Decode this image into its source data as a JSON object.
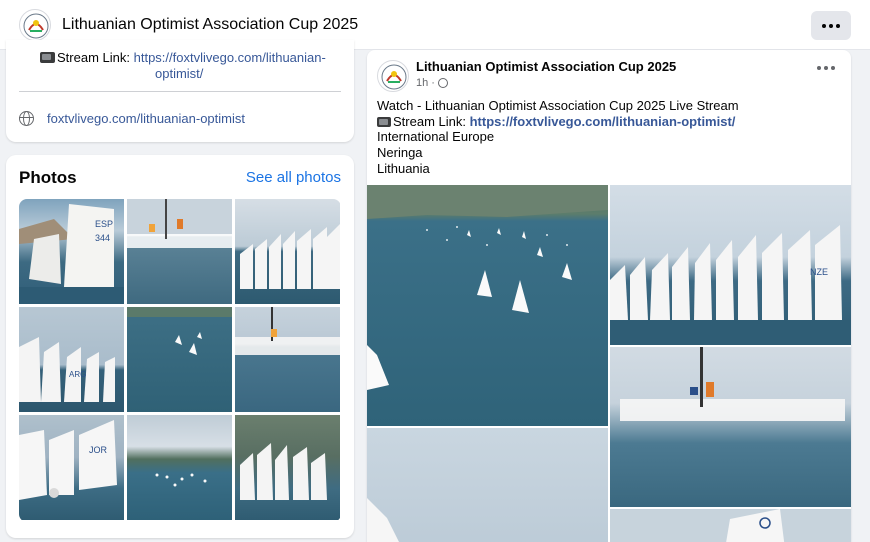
{
  "header": {
    "title": "Lithuanian Optimist Association Cup 2025",
    "more_icon": "more-horizontal-icon"
  },
  "intro": {
    "stream_prefix": "Stream Link:",
    "stream_url_line1": "https://foxtvlivego.com/lithuanian-",
    "stream_url_line2": "optimist/",
    "website": "foxtvlivego.com/lithuanian-optimist"
  },
  "photos": {
    "title": "Photos",
    "see_all": "See all photos"
  },
  "post": {
    "author": "Lithuanian Optimist Association Cup 2025",
    "time": "1h",
    "separator": "·",
    "line1": "Watch - Lithuanian Optimist Association Cup 2025 Live Stream",
    "stream_prefix": "Stream Link:",
    "stream_url": "https://foxtvlivego.com/lithuanian-optimist/",
    "line3": "International Europe",
    "line4": "Neringa",
    "line5": "Lithuania"
  },
  "colors": {
    "link": "#385898",
    "accent": "#1b74e4",
    "water": "#3f6f86",
    "sky": "#c9d6e1"
  }
}
